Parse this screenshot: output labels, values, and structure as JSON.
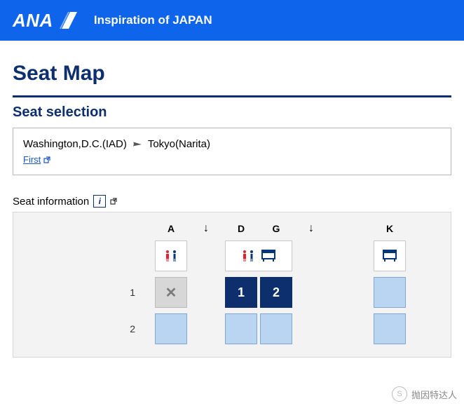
{
  "brand": {
    "name": "ANA",
    "tagline": "Inspiration of JAPAN"
  },
  "page": {
    "title": "Seat Map"
  },
  "seat_selection": {
    "heading": "Seat selection",
    "origin": "Washington,D.C.(IAD)",
    "destination": "Tokyo(Narita)",
    "cabin_label": "First"
  },
  "seat_info": {
    "label": "Seat information"
  },
  "columns": {
    "A": "A",
    "D": "D",
    "G": "G",
    "K": "K"
  },
  "rows": {
    "r1": "1",
    "r2": "2"
  },
  "selected": {
    "s1": "1",
    "s2": "2"
  },
  "unavail_glyph": "✕",
  "watermark": {
    "icon": "S",
    "text": "抛因特达人"
  }
}
